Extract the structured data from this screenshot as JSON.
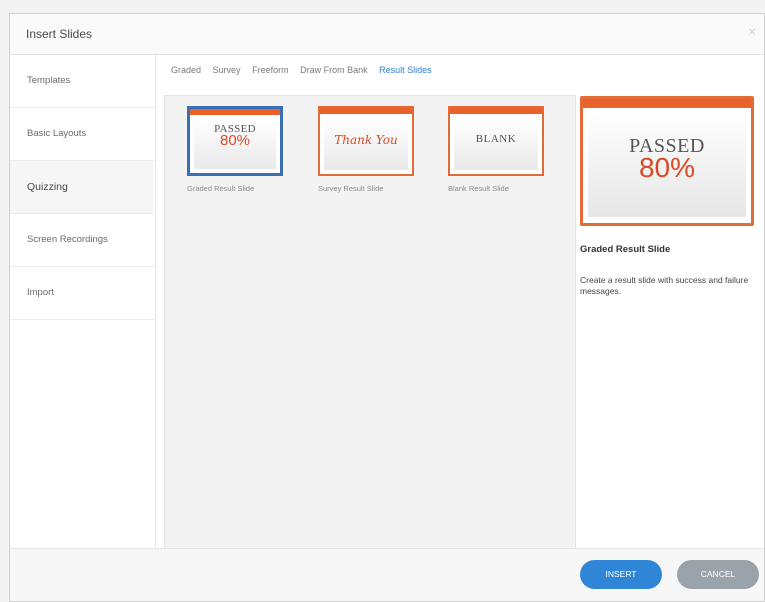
{
  "dialog": {
    "title": "Insert Slides",
    "close": "×"
  },
  "sidebar": {
    "items": [
      {
        "label": "Templates"
      },
      {
        "label": "Basic Layouts"
      },
      {
        "label": "Quizzing"
      },
      {
        "label": "Screen Recordings"
      },
      {
        "label": "Import"
      }
    ],
    "active": "Quizzing"
  },
  "tabs": {
    "items": [
      "Graded",
      "Survey",
      "Freeform",
      "Draw From Bank",
      "Result Slides"
    ],
    "active": "Result Slides"
  },
  "gallery": {
    "items": [
      {
        "caption": "Graded Result Slide",
        "line1": "PASSED",
        "line2": "80%",
        "selected": true
      },
      {
        "caption": "Survey Result Slide",
        "line1": "Thank You"
      },
      {
        "caption": "Blank Result Slide",
        "line1": "BLANK"
      }
    ]
  },
  "preview": {
    "line1": "PASSED",
    "line2": "80%",
    "title": "Graded Result Slide",
    "description": "Create a result slide with success and failure messages."
  },
  "footer": {
    "insert_label": "INSERT",
    "cancel_label": "CANCEL"
  },
  "colors": {
    "accent_orange": "#e8622a",
    "primary_blue": "#2f86d6",
    "cancel_gray": "#9aa3aa",
    "selected_border": "#3a6fb5"
  }
}
